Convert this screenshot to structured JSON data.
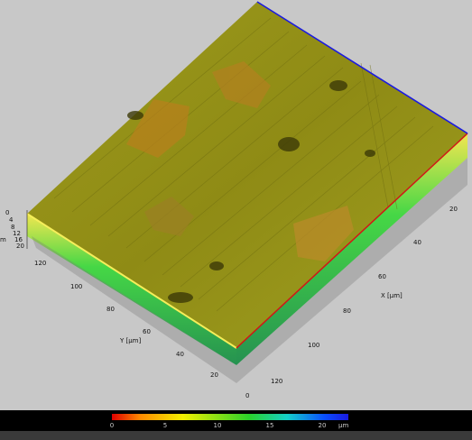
{
  "colors": {
    "background": "#c8c8c8",
    "surface_base": "#8d8a14",
    "edge_blue": "#1a1ae0",
    "edge_red": "#d01818",
    "edge_green": "#2ecc2e"
  },
  "surface": {
    "z_unit_label": "m",
    "z_ticks": [
      "0",
      "4",
      "8",
      "12",
      "16",
      "20"
    ],
    "y_axis_label": "Y [µm]",
    "y_ticks": [
      "120",
      "100",
      "80",
      "60",
      "40",
      "20",
      "0"
    ],
    "x_axis_label": "X [µm]",
    "x_ticks": [
      "20",
      "40",
      "60",
      "80",
      "100",
      "120"
    ]
  },
  "colorbar": {
    "ticks": [
      "0",
      "5",
      "10",
      "15",
      "20"
    ],
    "unit": "µm",
    "tick_values": [
      0,
      5,
      10,
      15,
      20
    ],
    "range": [
      0,
      22.5
    ]
  }
}
